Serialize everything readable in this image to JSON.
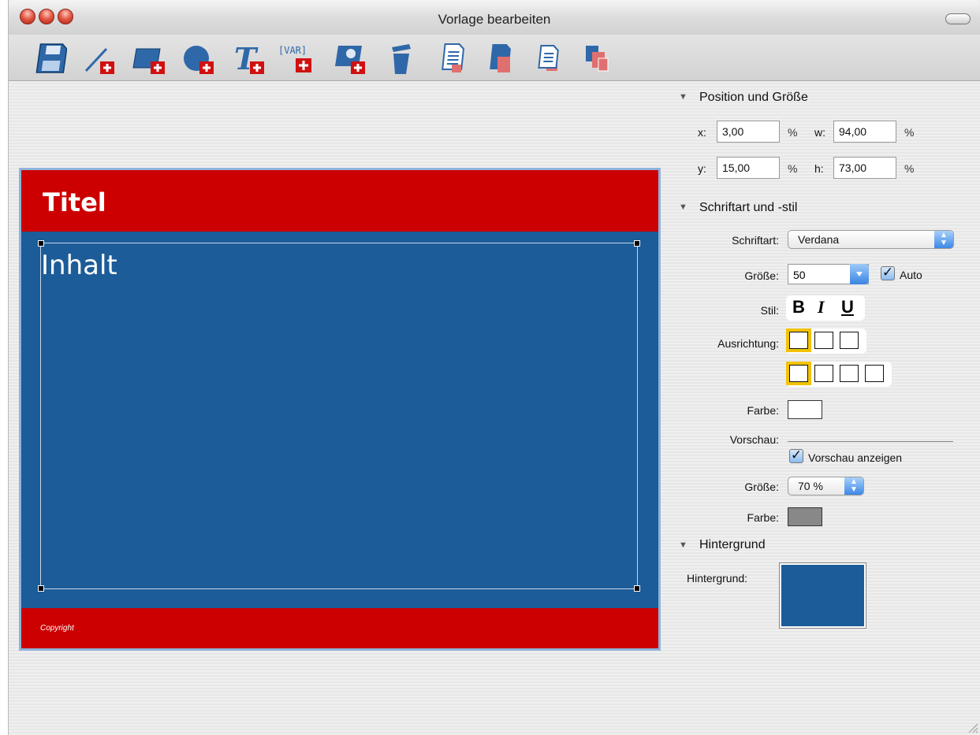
{
  "window": {
    "title": "Vorlage bearbeiten"
  },
  "toolbar": {
    "tools": [
      {
        "icon": "floppy-disk-icon"
      },
      {
        "icon": "add-line-icon"
      },
      {
        "icon": "add-rectangle-icon"
      },
      {
        "icon": "add-ellipse-icon"
      },
      {
        "icon": "add-text-icon"
      },
      {
        "icon": "add-variable-icon",
        "label": "[VAR]"
      },
      {
        "icon": "add-image-icon"
      },
      {
        "icon": "delete-icon"
      },
      {
        "icon": "bring-to-front-icon"
      },
      {
        "icon": "send-to-back-icon"
      },
      {
        "icon": "bring-forward-icon"
      },
      {
        "icon": "send-backward-icon"
      }
    ]
  },
  "slide": {
    "title": "Titel",
    "content": "Inhalt",
    "footer": "Copyright",
    "colors": {
      "bars": "#cc0000",
      "background": "#1c5c98"
    }
  },
  "inspector": {
    "position": {
      "heading": "Position und Größe",
      "x_label": "x:",
      "x": "3,00",
      "w_label": "w:",
      "w": "94,00",
      "y_label": "y:",
      "y": "15,00",
      "h_label": "h:",
      "h": "73,00",
      "unit": "%"
    },
    "font": {
      "heading": "Schriftart und -stil",
      "font_label": "Schriftart:",
      "font_value": "Verdana",
      "size_label": "Größe:",
      "size_value": "50",
      "auto_label": "Auto",
      "auto_checked": true,
      "style_label": "Stil:",
      "bold": "B",
      "italic": "I",
      "underline": "U",
      "align_label": "Ausrichtung:",
      "color_label": "Farbe:",
      "color": "#ffffff",
      "preview_label": "Vorschau:",
      "preview_show_label": "Vorschau anzeigen",
      "preview_checked": true,
      "preview_size_label": "Größe:",
      "preview_size_value": "70 %",
      "preview_color_label": "Farbe:",
      "preview_color": "#888888"
    },
    "background": {
      "heading": "Hintergrund",
      "label": "Hintergrund:",
      "color": "#1c5c98"
    }
  }
}
